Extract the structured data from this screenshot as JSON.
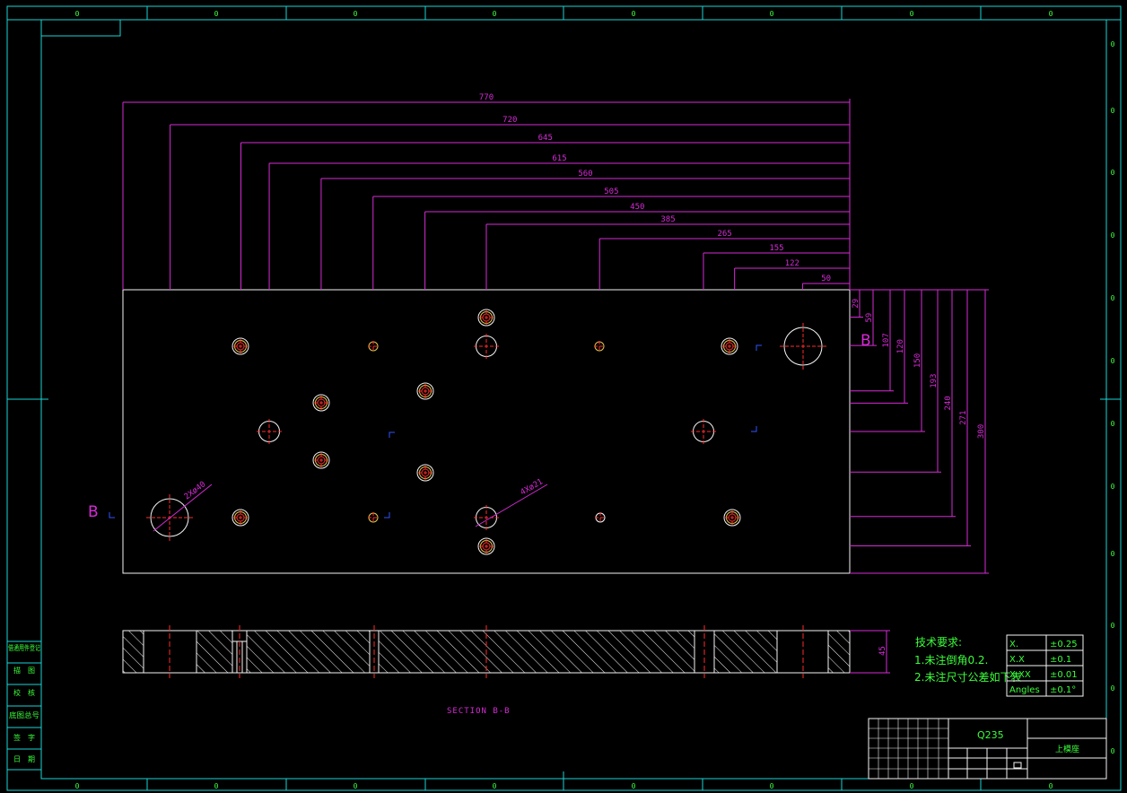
{
  "drawing": {
    "top_dims": [
      "770",
      "720",
      "645",
      "615",
      "560",
      "505",
      "450",
      "385",
      "265",
      "155",
      "122",
      "50"
    ],
    "right_dims": [
      "29",
      "59",
      "107",
      "120",
      "150",
      "193",
      "240",
      "271",
      "300"
    ],
    "thickness_dim": "45",
    "hole_note_1": "2Xø40",
    "hole_note_2": "4Xø21",
    "section_label_left": "B",
    "section_label_right": "B",
    "section_title": "SECTION B-B"
  },
  "notes": {
    "title": "技术要求:",
    "line1": "1.未注倒角0.2.",
    "line2": "2.未注尺寸公差如下表"
  },
  "tolerance_table": [
    {
      "label": "X.",
      "value": "±0.25"
    },
    {
      "label": "X.X",
      "value": "±0.1"
    },
    {
      "label": "X.XX",
      "value": "±0.01"
    },
    {
      "label": "Angles",
      "value": "±0.1°"
    }
  ],
  "title_block": {
    "material": "Q235",
    "part_name": "上模座"
  },
  "side_table": [
    "借通用件登记",
    "描　图",
    "校　核",
    "底图总号",
    "签　字",
    "日　期"
  ],
  "border_mark": "0",
  "colors": {
    "background": "#000000",
    "frame": "#19d4d4",
    "dimension": "#d62bd6",
    "outline": "#f4f4f4",
    "center": "#ff2a2a",
    "text": "#3bff3b"
  }
}
